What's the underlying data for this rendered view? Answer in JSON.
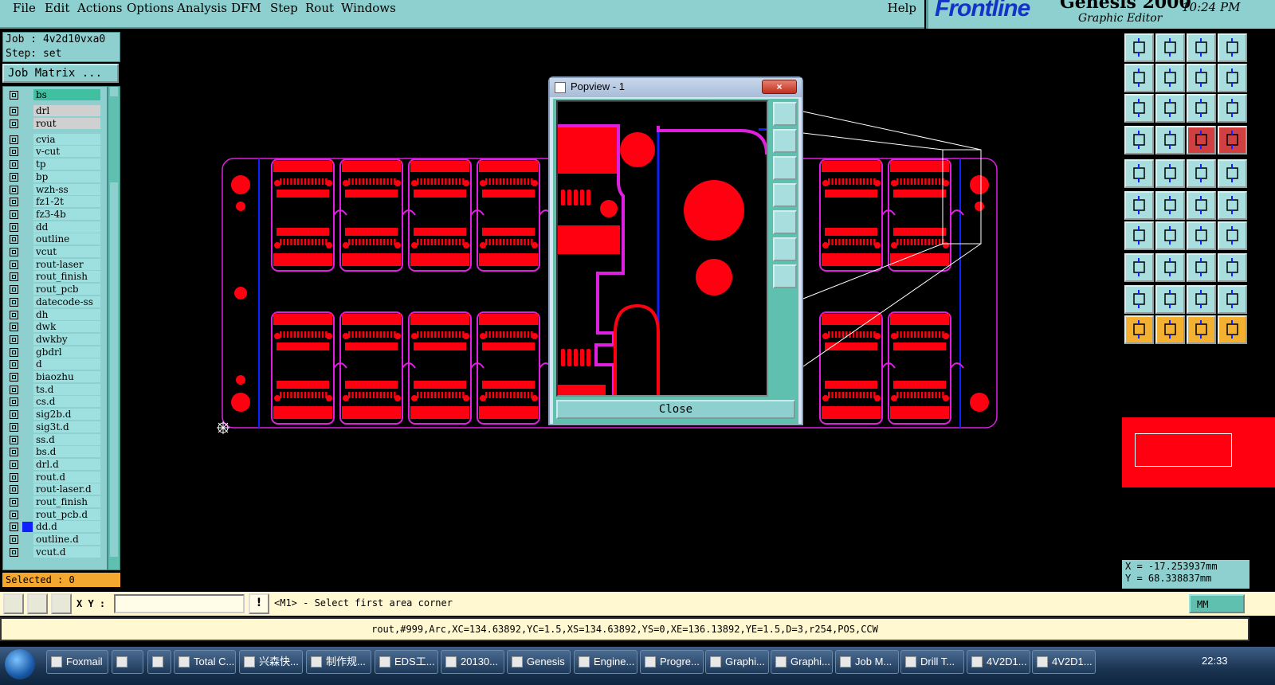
{
  "menu": {
    "items": [
      "File",
      "Edit",
      "Actions",
      "Options",
      "Analysis",
      "DFM",
      "Step",
      "Rout",
      "Windows"
    ],
    "help": "Help"
  },
  "brand": {
    "logo": "Frontline",
    "product": "Genesis 2000",
    "subtitle": "Graphic Editor",
    "clock": "10:24 PM"
  },
  "job": {
    "job_label": "Job : 4v2d10vxa0",
    "step_label": "Step: set",
    "matrix_button": "Job Matrix ..."
  },
  "layers": [
    "bs",
    "drl",
    "rout",
    "cvia",
    "v-cut",
    "tp",
    "bp",
    "wzh-ss",
    "fz1-2t",
    "fz3-4b",
    "dd",
    "outline",
    "vcut",
    "rout-laser",
    "rout_finish",
    "rout_pcb",
    "datecode-ss",
    "dh",
    "dwk",
    "dwkby",
    "gbdrl",
    "d",
    "biaozhu",
    "ts.d",
    "cs.d",
    "sig2b.d",
    "sig3t.d",
    "ss.d",
    "bs.d",
    "drl.d",
    "rout.d",
    "rout-laser.d",
    "rout_finish",
    "rout_pcb.d",
    "dd.d",
    "outline.d",
    "vcut.d"
  ],
  "selected": "Selected : 0",
  "coords": {
    "x": "X = -17.253937mm",
    "y": "Y = 68.338837mm"
  },
  "command": {
    "xy_label": "X Y :",
    "prompt": "<M1> - Select first area corner",
    "units": "MM"
  },
  "feature_line": "rout,#999,Arc,XC=134.63892,YC=1.5,XS=134.63892,YS=0,XE=136.13892,YE=1.5,D=3,r254,POS,CCW",
  "popview": {
    "title": "Popview - 1",
    "close": "Close",
    "x_btn": "×"
  },
  "taskbar": {
    "items": [
      "Foxmail",
      "",
      "",
      "Total C...",
      "兴森快...",
      "制作规...",
      "EDS工...",
      "20130...",
      "Genesis",
      "Engine...",
      "Progre...",
      "Graphi...",
      "Graphi...",
      "Job M...",
      "Drill T...",
      "4V2D1...",
      "4V2D1..."
    ],
    "time": "22:33"
  },
  "colors": {
    "board_red": "#ff0010",
    "rout_magenta": "#e020e0",
    "panel_teal": "#8ecfcf",
    "accent_blue": "#1020ff"
  }
}
